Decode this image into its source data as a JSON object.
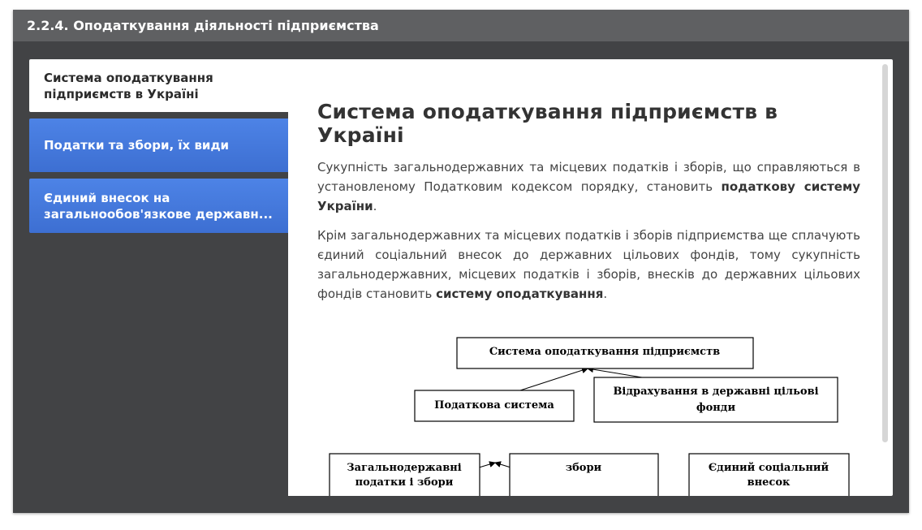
{
  "window": {
    "title": "2.2.4. Оподаткування діяльності підприємства"
  },
  "tabs": [
    {
      "label": "Система оподаткування підприємств в Україні",
      "active": true
    },
    {
      "label": "Податки та збори, їх види",
      "active": false
    },
    {
      "label": "Єдиний внесок на загальнообов'язкове державн...",
      "active": false
    }
  ],
  "content": {
    "heading": "Система оподаткування підприємств в Україні",
    "para1": {
      "text": "Сукупність загальнодержавних та місцевих податків і зборів, що справляються в установленому Податковим кодексом порядку, становить ",
      "bold": "податкову систему України",
      "end": "."
    },
    "para2": {
      "text": "Крім загальнодержавних та місцевих податків і зборів підприємства ще сплачують єдиний соціальний внесок до державних цільових фондів, тому сукупність загальнодержавних, місцевих податків і зборів, внесків до державних цільових фондів становить ",
      "bold": "систему оподаткування",
      "end": "."
    },
    "diagram": {
      "root": "Система оподаткування підприємств",
      "tax_system": "Податкова система",
      "funds_line1": "Відрахування в державні цільові",
      "funds_line2": "фонди",
      "national_line1": "Загальнодержавні",
      "national_line2": "податки і збори",
      "fees": "збори",
      "social_line1": "Єдиний соціальний",
      "social_line2": "внесок"
    }
  }
}
